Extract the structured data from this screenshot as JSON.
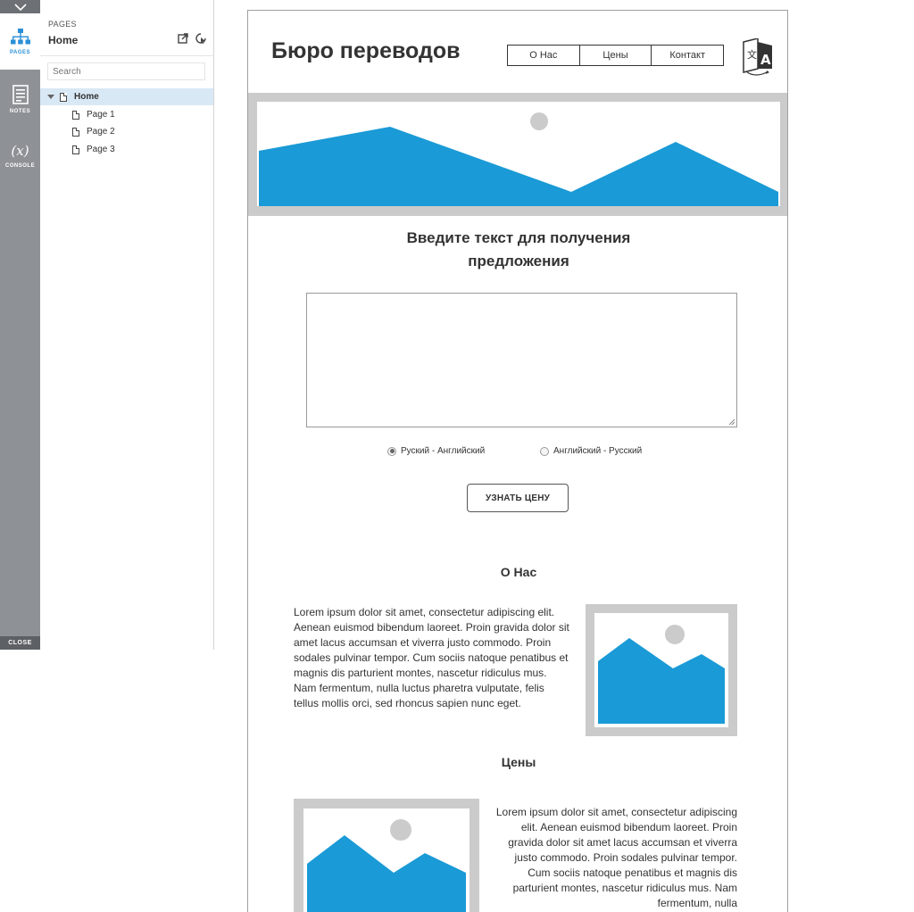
{
  "sidebar": {
    "tabs": [
      {
        "label": "PAGES",
        "icon": "sitemap-icon"
      },
      {
        "label": "NOTES",
        "icon": "notes-icon"
      },
      {
        "label": "CONSOLE",
        "icon": "console-icon",
        "glyph": "(x)"
      }
    ],
    "close_label": "CLOSE"
  },
  "pages_panel": {
    "section_label": "PAGES",
    "current_page": "Home",
    "search_placeholder": "Search",
    "tree": [
      {
        "label": "Home",
        "selected": true
      },
      {
        "label": "Page 1"
      },
      {
        "label": "Page 2"
      },
      {
        "label": "Page 3"
      }
    ]
  },
  "site": {
    "title": "Бюро переводов",
    "nav": [
      "О Нас",
      "Цены",
      "Контакт"
    ],
    "prompt_line1": "Введите текст для получения",
    "prompt_line2": "предложения",
    "textarea_value": "",
    "radio_options": [
      {
        "label": "Руский - Английский",
        "checked": true
      },
      {
        "label": "Английский - Русский",
        "checked": false
      }
    ],
    "button_label": "УЗНАТЬ ЦЕНУ",
    "about_title": "О Нас",
    "about_text": "Lorem ipsum dolor sit amet, consectetur adipiscing elit. Aenean euismod bibendum laoreet. Proin gravida dolor sit amet lacus accumsan et viverra justo commodo. Proin sodales pulvinar tempor. Cum sociis natoque penatibus et magnis dis parturient montes, nascetur ridiculus mus. Nam fermentum, nulla luctus pharetra vulputate, felis tellus mollis orci, sed rhoncus sapien nunc eget.",
    "prices_title": "Цены",
    "prices_text": "Lorem ipsum dolor sit amet, consectetur adipiscing elit. Aenean euismod bibendum laoreet. Proin gravida dolor sit amet lacus accumsan et viverra justo commodo. Proin sodales pulvinar tempor. Cum sociis natoque penatibus et magnis dis parturient montes, nascetur ridiculus mus. Nam fermentum, nulla"
  },
  "colors": {
    "accent": "#2a8fd6",
    "placeholder_blue": "#1a9ad6",
    "placeholder_frame": "#cbcbcb",
    "rail": "#8e9196"
  }
}
